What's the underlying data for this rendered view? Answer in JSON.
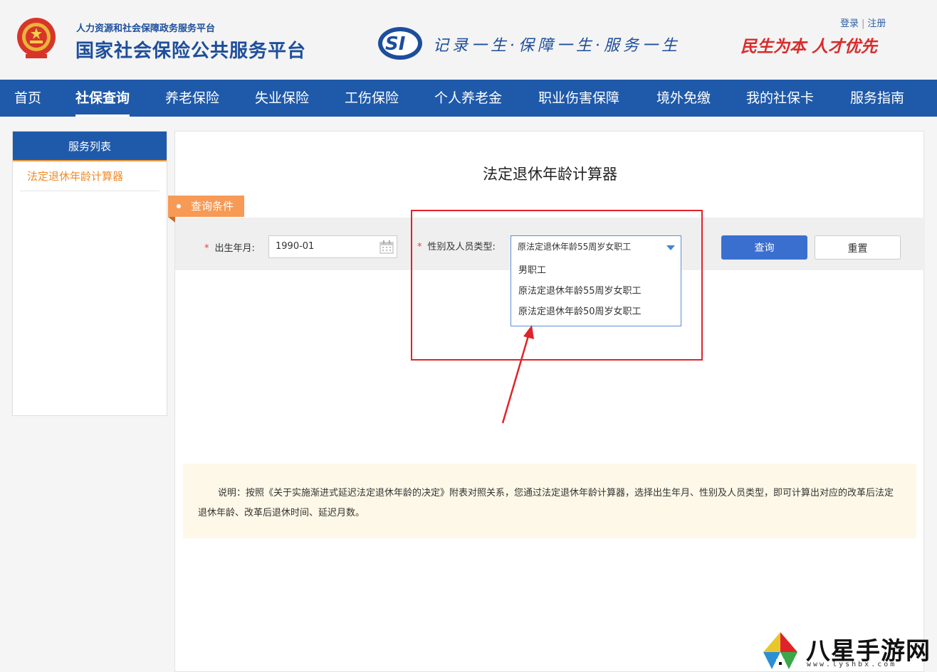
{
  "header": {
    "sub_title": "人力资源和社会保障政务服务平台",
    "main_title": "国家社会保险公共服务平台",
    "slogan": "记录一生·保障一生·服务一生",
    "slogan2": "民生为本 人才优先",
    "login": "登录",
    "register": "注册",
    "separator": "|"
  },
  "nav": {
    "items": [
      {
        "label": "首页"
      },
      {
        "label": "社保查询",
        "active": true
      },
      {
        "label": "养老保险"
      },
      {
        "label": "失业保险"
      },
      {
        "label": "工伤保险"
      },
      {
        "label": "个人养老金"
      },
      {
        "label": "职业伤害保障"
      },
      {
        "label": "境外免缴"
      },
      {
        "label": "我的社保卡"
      },
      {
        "label": "服务指南"
      }
    ]
  },
  "sidebar": {
    "title": "服务列表",
    "items": [
      {
        "label": "法定退休年龄计算器"
      }
    ]
  },
  "main": {
    "title": "法定退休年龄计算器",
    "condition_tag": "查询条件",
    "required_mark": "*",
    "birth_label": "出生年月:",
    "birth_value": "1990-01",
    "type_label": "性别及人员类型:",
    "type_selected": "原法定退休年龄55周岁女职工",
    "type_options": [
      "男职工",
      "原法定退休年龄55周岁女职工",
      "原法定退休年龄50周岁女职工"
    ],
    "query_button": "查询",
    "reset_button": "重置",
    "note": "说明：按照《关于实施渐进式延迟法定退休年龄的决定》附表对照关系，您通过法定退休年龄计算器，选择出生年月、性别及人员类型，即可计算出对应的改革后法定退休年龄、改革后退休时间、延迟月数。"
  },
  "watermark": {
    "text": "八星手游网",
    "url": "www.lyshbx.com"
  },
  "colors": {
    "nav_bg": "#1f5aaa",
    "accent_orange": "#f79a55",
    "primary_button": "#3a6fd0",
    "annotation_red": "#e0232b"
  }
}
